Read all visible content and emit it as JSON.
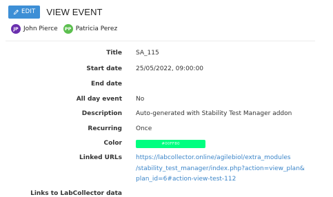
{
  "header": {
    "edit_label": "EDIT",
    "title": "VIEW EVENT"
  },
  "participants": [
    {
      "initials": "JP",
      "name": "John Pierce",
      "color": "#6a2fae"
    },
    {
      "initials": "PP",
      "name": "Patricia Perez",
      "color": "#5cbf4f"
    }
  ],
  "fields": {
    "title": {
      "label": "Title",
      "value": "SA_115"
    },
    "start_date": {
      "label": "Start date",
      "value": "25/05/2022, 09:00:00"
    },
    "end_date": {
      "label": "End date",
      "value": ""
    },
    "all_day": {
      "label": "All day event",
      "value": "No"
    },
    "description": {
      "label": "Description",
      "value": "Auto-generated with Stability Test Manager addon"
    },
    "recurring": {
      "label": "Recurring",
      "value": "Once"
    },
    "color": {
      "label": "Color",
      "value": "#00FF80"
    },
    "linked_urls": {
      "label": "Linked URLs",
      "lines": [
        "https://labcollector.online/agilebiol/extra_modules",
        "/stability_test_manager/index.php?action=view_plan&",
        "plan_id=6#action-view-test-112"
      ]
    },
    "links_lc": {
      "label": "Links to LabCollector data",
      "value": ""
    }
  }
}
